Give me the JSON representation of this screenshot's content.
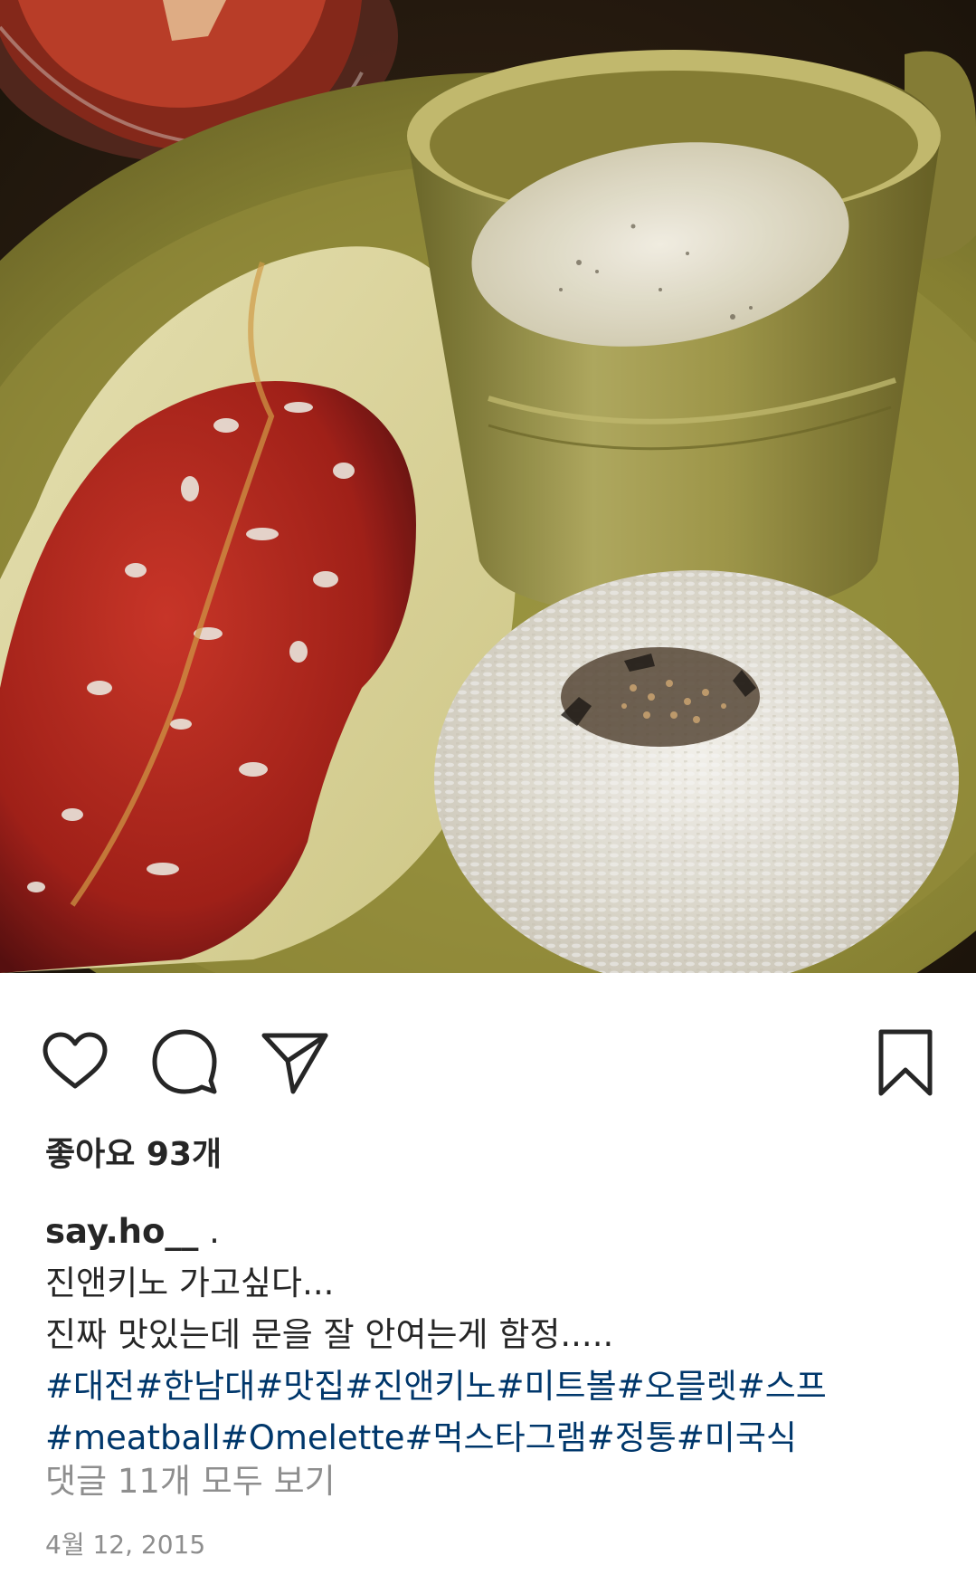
{
  "post": {
    "photo_icon": "food-photo",
    "likes_label": "좋아요 93개",
    "username": "say.ho__",
    "username_suffix": " .",
    "caption_lines": [
      "진앤키노 가고싶다...",
      "진짜 맛있는데 문을 잘 안여는게 함정....."
    ],
    "hashtags_line1": [
      "#대전",
      "#한남대",
      "#맛집",
      "#진앤키노",
      "#미트볼",
      "#오믈렛",
      "#스프"
    ],
    "hashtags_line2": [
      "#meatball",
      "#Omelette",
      "#먹스타그램",
      "#정통",
      "#미국식"
    ],
    "view_comments": "댓글 11개 모두 보기",
    "date": "4월 12, 2015"
  },
  "actions": {
    "like_icon": "heart-icon",
    "comment_icon": "comment-icon",
    "share_icon": "paper-plane-icon",
    "save_icon": "bookmark-icon"
  },
  "colors": {
    "text": "#262626",
    "hashtag": "#00376b",
    "muted": "#8e8e8e",
    "plate": "#8f8a3a",
    "sauce": "#b8291f",
    "rice": "#f4f1ea"
  }
}
